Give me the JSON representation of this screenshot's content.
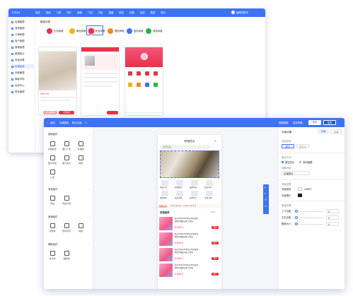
{
  "back_window": {
    "logo": "LOGO",
    "nav": [
      "首页",
      "商品",
      "订单",
      "用户",
      "营销",
      "门店",
      "分销",
      "直播",
      "财务",
      "设置",
      "应用",
      "数据",
      "统计"
    ],
    "top_right": "管理员账号",
    "section_title": "模板列表",
    "templates": [
      {
        "label": "红色风格",
        "color": "#e8334a"
      },
      {
        "label": "黄色风格",
        "color": "#f5b400"
      },
      {
        "label": "粉色风格",
        "color": "#e8334a"
      },
      {
        "label": "橙色风格",
        "color": "#f28a1c"
      },
      {
        "label": "蓝色风格",
        "color": "#3d73f3"
      },
      {
        "label": "绿色风格",
        "color": "#2bb24c"
      }
    ],
    "sidebar": [
      "店铺管理",
      "商品管理",
      "订单管理",
      "用户管理",
      "营销管理",
      "数据统计",
      "系统设置",
      "店铺装修",
      "页面管理",
      "模板市场",
      "应用中心",
      "财务管理"
    ],
    "sidebar_active": 7,
    "price": "¥38.00",
    "product_btn": "立即购买",
    "cart_btn": "加入购物车"
  },
  "front_window": {
    "back_label": "返回",
    "page_name": "店铺首页",
    "page_tag": "默认页面",
    "top_actions": [
      "视频教程",
      "保存草稿"
    ],
    "save_button": "保存",
    "publish_button": "发布",
    "groups": [
      {
        "title": "基础组件",
        "items": [
          "店铺搜索",
          "图片广告",
          "轮播图",
          "图文导航",
          "图片魔方",
          "视频",
          "公告"
        ]
      },
      {
        "title": "商品组件",
        "items": [
          "商品",
          "商品分组"
        ]
      },
      {
        "title": "营销组件",
        "items": [
          "优惠券",
          "限时折扣",
          "拼团"
        ]
      },
      {
        "title": "辅助组件",
        "items": [
          "富文本",
          "辅助线"
        ]
      }
    ],
    "phone": {
      "title": "商城首页",
      "search_placeholder": "搜索商品",
      "quick_labels": [
        "新品上市",
        "热销推荐",
        "品牌特卖",
        "会员专享",
        "限时秒杀",
        "积分商城",
        "领券中心",
        "全部分类"
      ],
      "notice_tag": "店铺公告",
      "notice_text": "欢迎光临本店，新用户首单立减",
      "section_title": "热销推荐",
      "section_more": "更多>",
      "products": [
        {
          "name": "猫牙40包2108型定单包邮免",
          "desc": "邮纸巾抽纸家用卫生纸",
          "price": "¥168.5",
          "buy": "购买"
        },
        {
          "name": "猫牙40包2108型定单包邮免",
          "desc": "邮纸巾抽纸家用卫生纸",
          "price": "¥168.5",
          "buy": "购买"
        },
        {
          "name": "猫牙40包2108型定单包邮免",
          "desc": "邮纸巾抽纸家用卫生纸",
          "price": "¥168.5",
          "buy": "购买"
        },
        {
          "name": "猫牙40包2108型定单包邮免",
          "desc": "邮纸巾抽纸家用卫生纸",
          "price": "¥168.5",
          "buy": "购买"
        }
      ]
    },
    "right_panel": {
      "title": "页面设置",
      "tabs": [
        "页面",
        "全局"
      ],
      "row1_label": "页面名称",
      "row1_options": [
        "默认",
        "自定义"
      ],
      "row2_label": "展示方式",
      "row2_options": [
        "固定显示",
        "滚动隐藏"
      ],
      "row3_label": "标题内容",
      "row3_value": "店铺首页",
      "row4_label": "背景设置",
      "row4_items": [
        "背景颜色",
        "背景图片"
      ],
      "row4_color": "#ffffff",
      "row5_label": "距离设置",
      "sliders": [
        {
          "label": "上下边距",
          "value": "0"
        },
        {
          "label": "左右边距",
          "value": "0"
        },
        {
          "label": "圆角大小",
          "value": "0"
        }
      ]
    }
  }
}
